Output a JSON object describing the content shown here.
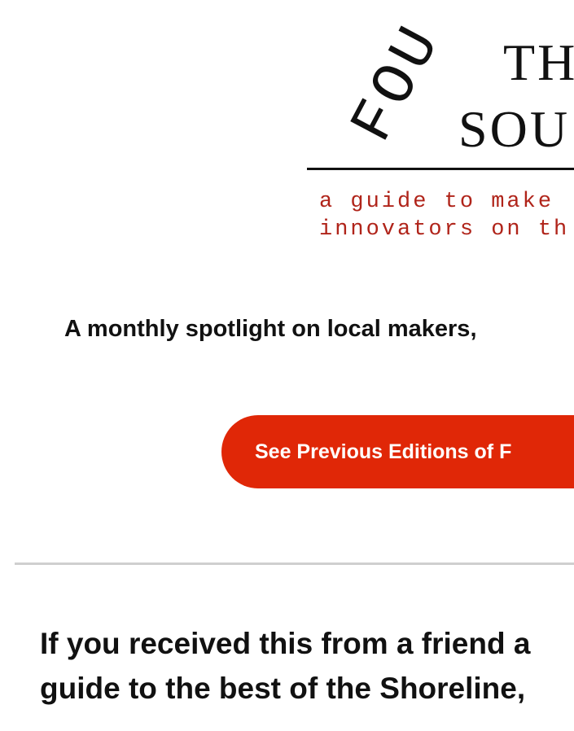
{
  "logo": {
    "word_found": "FOU",
    "title_line_1": "TH",
    "title_line_2": "SOU",
    "subtitle_line_1": "a guide to make",
    "subtitle_line_2": "innovators on th"
  },
  "tagline": "A monthly spotlight on local makers,",
  "cta": {
    "label": "See Previous Editions of F",
    "color": "#e02707"
  },
  "message": {
    "line_1": "If you received this from a friend a",
    "line_2": "guide to the best of the Shoreline,"
  },
  "colors": {
    "accent": "#e02707",
    "logo_subtitle": "#b0241a",
    "text": "#111111",
    "divider": "#cfcfcf"
  }
}
